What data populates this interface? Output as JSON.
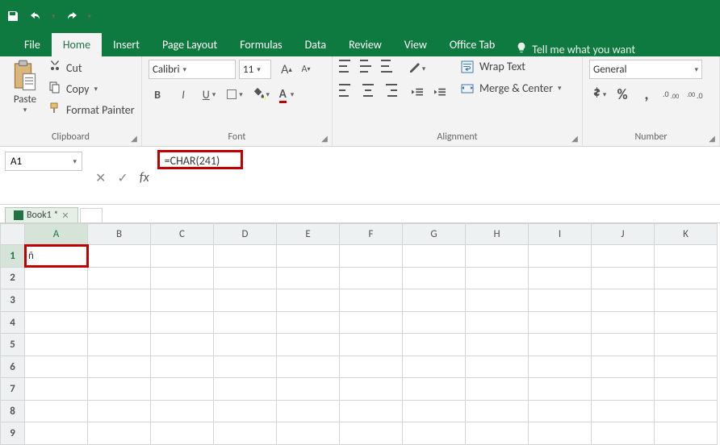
{
  "qat": {
    "save": "save",
    "undo": "undo",
    "redo": "redo"
  },
  "tabs": {
    "file": "File",
    "home": "Home",
    "insert": "Insert",
    "pageLayout": "Page Layout",
    "formulas": "Formulas",
    "data": "Data",
    "review": "Review",
    "view": "View",
    "officeTab": "Office Tab",
    "tellMe": "Tell me what you want"
  },
  "clipboard": {
    "paste": "Paste",
    "cut": "Cut",
    "copy": "Copy",
    "formatPainter": "Format Painter",
    "groupLabel": "Clipboard"
  },
  "font": {
    "name": "Calibri",
    "size": "11",
    "bold": "B",
    "italic": "I",
    "underline": "U",
    "fontColorLetter": "A",
    "groupLabel": "Font"
  },
  "alignment": {
    "wrapText": "Wrap Text",
    "mergeCenter": "Merge & Center",
    "groupLabel": "Alignment"
  },
  "number": {
    "format": "General",
    "percent": "%",
    "comma": ",",
    "groupLabel": "Number"
  },
  "nameBox": "A1",
  "formula": "=CHAR(241)",
  "workbookTab": "Book1 *",
  "columns": [
    "A",
    "B",
    "C",
    "D",
    "E",
    "F",
    "G",
    "H",
    "I",
    "J",
    "K"
  ],
  "rows": [
    "1",
    "2",
    "3",
    "4",
    "5",
    "6",
    "7",
    "8",
    "9"
  ],
  "activeCol": "A",
  "activeRow": "1",
  "cellA1": "ñ"
}
